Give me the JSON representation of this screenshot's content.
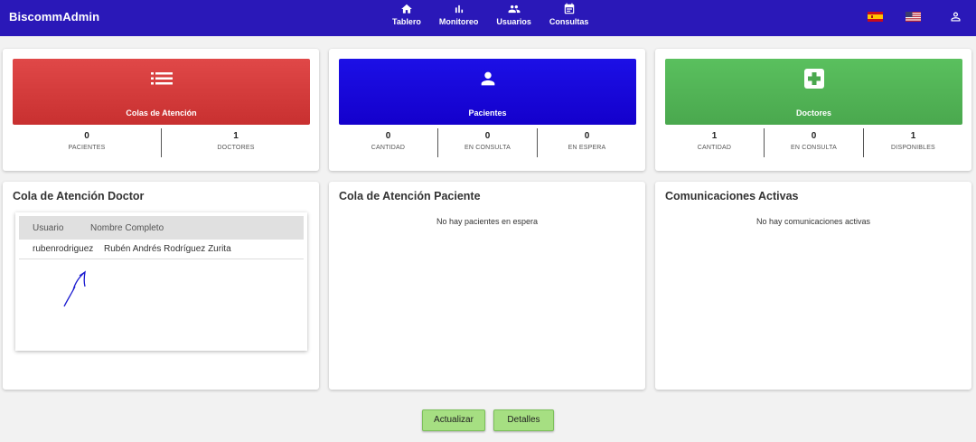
{
  "app": {
    "title": "BiscommAdmin"
  },
  "nav": {
    "items": [
      {
        "label": "Tablero",
        "icon": "home-icon"
      },
      {
        "label": "Monitoreo",
        "icon": "bar-chart-icon"
      },
      {
        "label": "Usuarios",
        "icon": "people-icon"
      },
      {
        "label": "Consultas",
        "icon": "calendar-icon"
      }
    ]
  },
  "header_icons": {
    "lang_es": "spain-flag-icon",
    "lang_en": "us-flag-icon",
    "account": "user-icon"
  },
  "colors": {
    "topbar": "#2a18b8",
    "red": "#d83c3c",
    "blue": "#1808dc",
    "green": "#52b456",
    "button": "#a6df82"
  },
  "summary": {
    "colas": {
      "title": "Colas de Atención",
      "icon": "list-icon",
      "stats": [
        {
          "value": "0",
          "label": "PACIENTES"
        },
        {
          "value": "1",
          "label": "DOCTORES"
        }
      ]
    },
    "pacientes": {
      "title": "Pacientes",
      "icon": "person-icon",
      "stats": [
        {
          "value": "0",
          "label": "CANTIDAD"
        },
        {
          "value": "0",
          "label": "EN CONSULTA"
        },
        {
          "value": "0",
          "label": "EN ESPERA"
        }
      ]
    },
    "doctores": {
      "title": "Doctores",
      "icon": "medical-cross-icon",
      "stats": [
        {
          "value": "1",
          "label": "CANTIDAD"
        },
        {
          "value": "0",
          "label": "EN CONSULTA"
        },
        {
          "value": "1",
          "label": "DISPONIBLES"
        }
      ]
    }
  },
  "panels": {
    "doctor_queue": {
      "title": "Cola de Atención Doctor",
      "columns": [
        "Usuario",
        "Nombre Completo"
      ],
      "rows": [
        {
          "usuario": "rubenrodriguez",
          "nombre": "Rubén Andrés Rodríguez Zurita"
        }
      ]
    },
    "patient_queue": {
      "title": "Cola de Atención Paciente",
      "empty": "No hay pacientes en espera"
    },
    "communications": {
      "title": "Comunicaciones Activas",
      "empty": "No hay comunicaciones activas"
    }
  },
  "actions": {
    "refresh": "Actualizar",
    "details": "Detalles"
  }
}
